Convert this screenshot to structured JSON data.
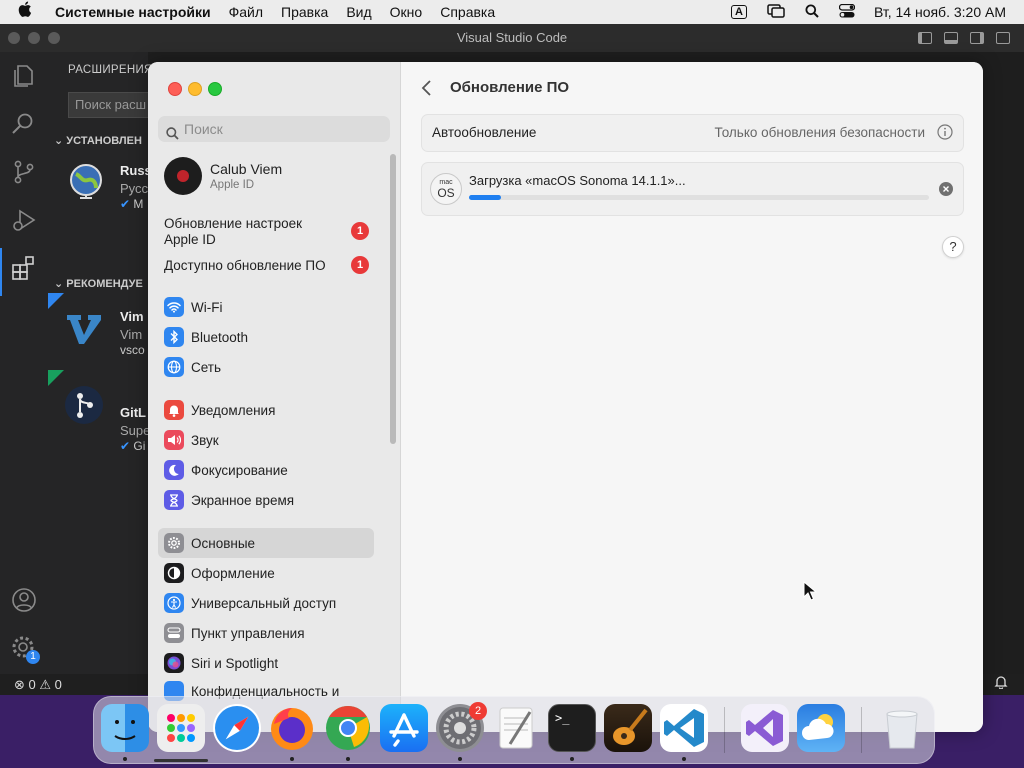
{
  "menubar": {
    "app_name": "Системные настройки",
    "items": [
      "Файл",
      "Правка",
      "Вид",
      "Окно",
      "Справка"
    ],
    "input_badge": "A",
    "clock": "Вт, 14 нояб.  3:20 AM"
  },
  "vscode": {
    "title": "Visual Studio Code",
    "sidebar": {
      "header": "РАСШИРЕНИЯ",
      "search_placeholder": "Поиск расш",
      "installed_header": "УСТАНОВЛЕН",
      "installed_ext": {
        "name": "Russ",
        "desc": "Русс",
        "publisher": "M"
      },
      "recommended_header": "РЕКОМЕНДУЕ",
      "recommended": [
        {
          "name": "Vim",
          "desc": "Vim",
          "publisher": "vsco"
        },
        {
          "name": "GitL",
          "desc": "Supe",
          "publisher": "Gi"
        }
      ]
    },
    "status": {
      "errors": "0",
      "warnings": "0"
    },
    "settings_badge": "1"
  },
  "settings": {
    "search_placeholder": "Поиск",
    "account": {
      "name": "Calub Viem",
      "sub": "Apple ID"
    },
    "alerts": [
      {
        "label": "Обновление настроек Apple ID",
        "badge": "1"
      },
      {
        "label": "Доступно обновление ПО",
        "badge": "1"
      }
    ],
    "groups": [
      [
        {
          "label": "Wi-Fi",
          "icon": "wifi-icon",
          "color": "#2f86f0"
        },
        {
          "label": "Bluetooth",
          "icon": "bluetooth-icon",
          "color": "#2f86f0"
        },
        {
          "label": "Сеть",
          "icon": "globe-icon",
          "color": "#2f86f0"
        }
      ],
      [
        {
          "label": "Уведомления",
          "icon": "bell-icon",
          "color": "#eb4a3f"
        },
        {
          "label": "Звук",
          "icon": "speaker-icon",
          "color": "#eb4a5c"
        },
        {
          "label": "Фокусирование",
          "icon": "moon-icon",
          "color": "#5e5ce6"
        },
        {
          "label": "Экранное время",
          "icon": "hourglass-icon",
          "color": "#5e5ce6"
        }
      ],
      [
        {
          "label": "Основные",
          "icon": "gear-icon",
          "color": "#8e8e93",
          "selected": true
        },
        {
          "label": "Оформление",
          "icon": "appearance-icon",
          "color": "#1c1c1e"
        },
        {
          "label": "Универсальный доступ",
          "icon": "accessibility-icon",
          "color": "#2f86f0"
        },
        {
          "label": "Пункт управления",
          "icon": "control-center-icon",
          "color": "#8e8e93"
        },
        {
          "label": "Siri и Spotlight",
          "icon": "siri-icon",
          "color": "#7a4fd6"
        },
        {
          "label": "Конфиденциальность и",
          "icon": "hand-icon",
          "color": "#2f86f0"
        }
      ]
    ],
    "main": {
      "title": "Обновление ПО",
      "auto_update_label": "Автообновление",
      "auto_update_value": "Только обновления безопасности",
      "download_label": "Загрузка «macOS Sonoma 14.1.1»...",
      "download_progress": 0.07,
      "os_icon_text_top": "mac",
      "os_icon_text_bottom": "OS",
      "help": "?"
    }
  },
  "dock": {
    "apps": [
      "Finder",
      "Launchpad",
      "Safari",
      "Firefox",
      "Chrome",
      "App Store",
      "Системные настройки",
      "TextEdit",
      "Терминал",
      "GarageBand",
      "Visual Studio Code",
      "Visual Studio",
      "Погода",
      "Корзина"
    ],
    "settings_badge": "2",
    "terminal_text": ">_"
  }
}
